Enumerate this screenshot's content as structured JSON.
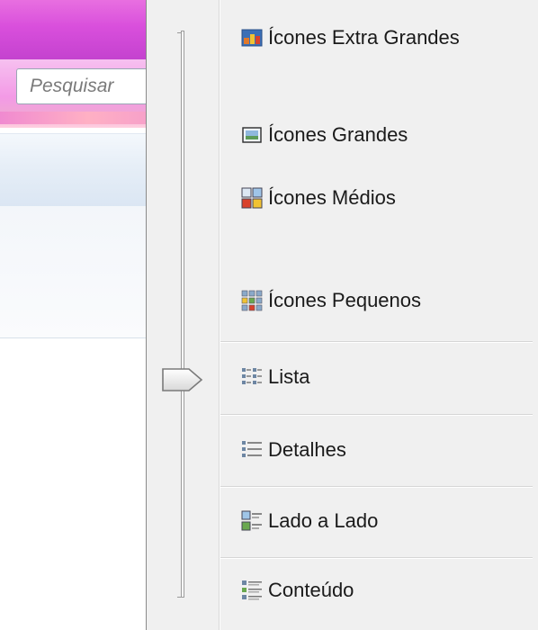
{
  "background_window": {
    "search": {
      "placeholder": "Pesquisar"
    }
  },
  "view_menu": {
    "items": [
      {
        "label": "Ícones Extra Grandes",
        "icon": "extra-large-icons-icon"
      },
      {
        "label": "Ícones Grandes",
        "icon": "large-icons-icon"
      },
      {
        "label": "Ícones Médios",
        "icon": "medium-icons-icon"
      },
      {
        "label": "Ícones Pequenos",
        "icon": "small-icons-icon"
      },
      {
        "label": "Lista",
        "icon": "list-icon"
      },
      {
        "label": "Detalhes",
        "icon": "details-icon"
      },
      {
        "label": "Lado a Lado",
        "icon": "tiles-icon"
      },
      {
        "label": "Conteúdo",
        "icon": "content-icon"
      }
    ],
    "selected_item": "Lista",
    "slider": {
      "selected_level": "Lista"
    }
  }
}
